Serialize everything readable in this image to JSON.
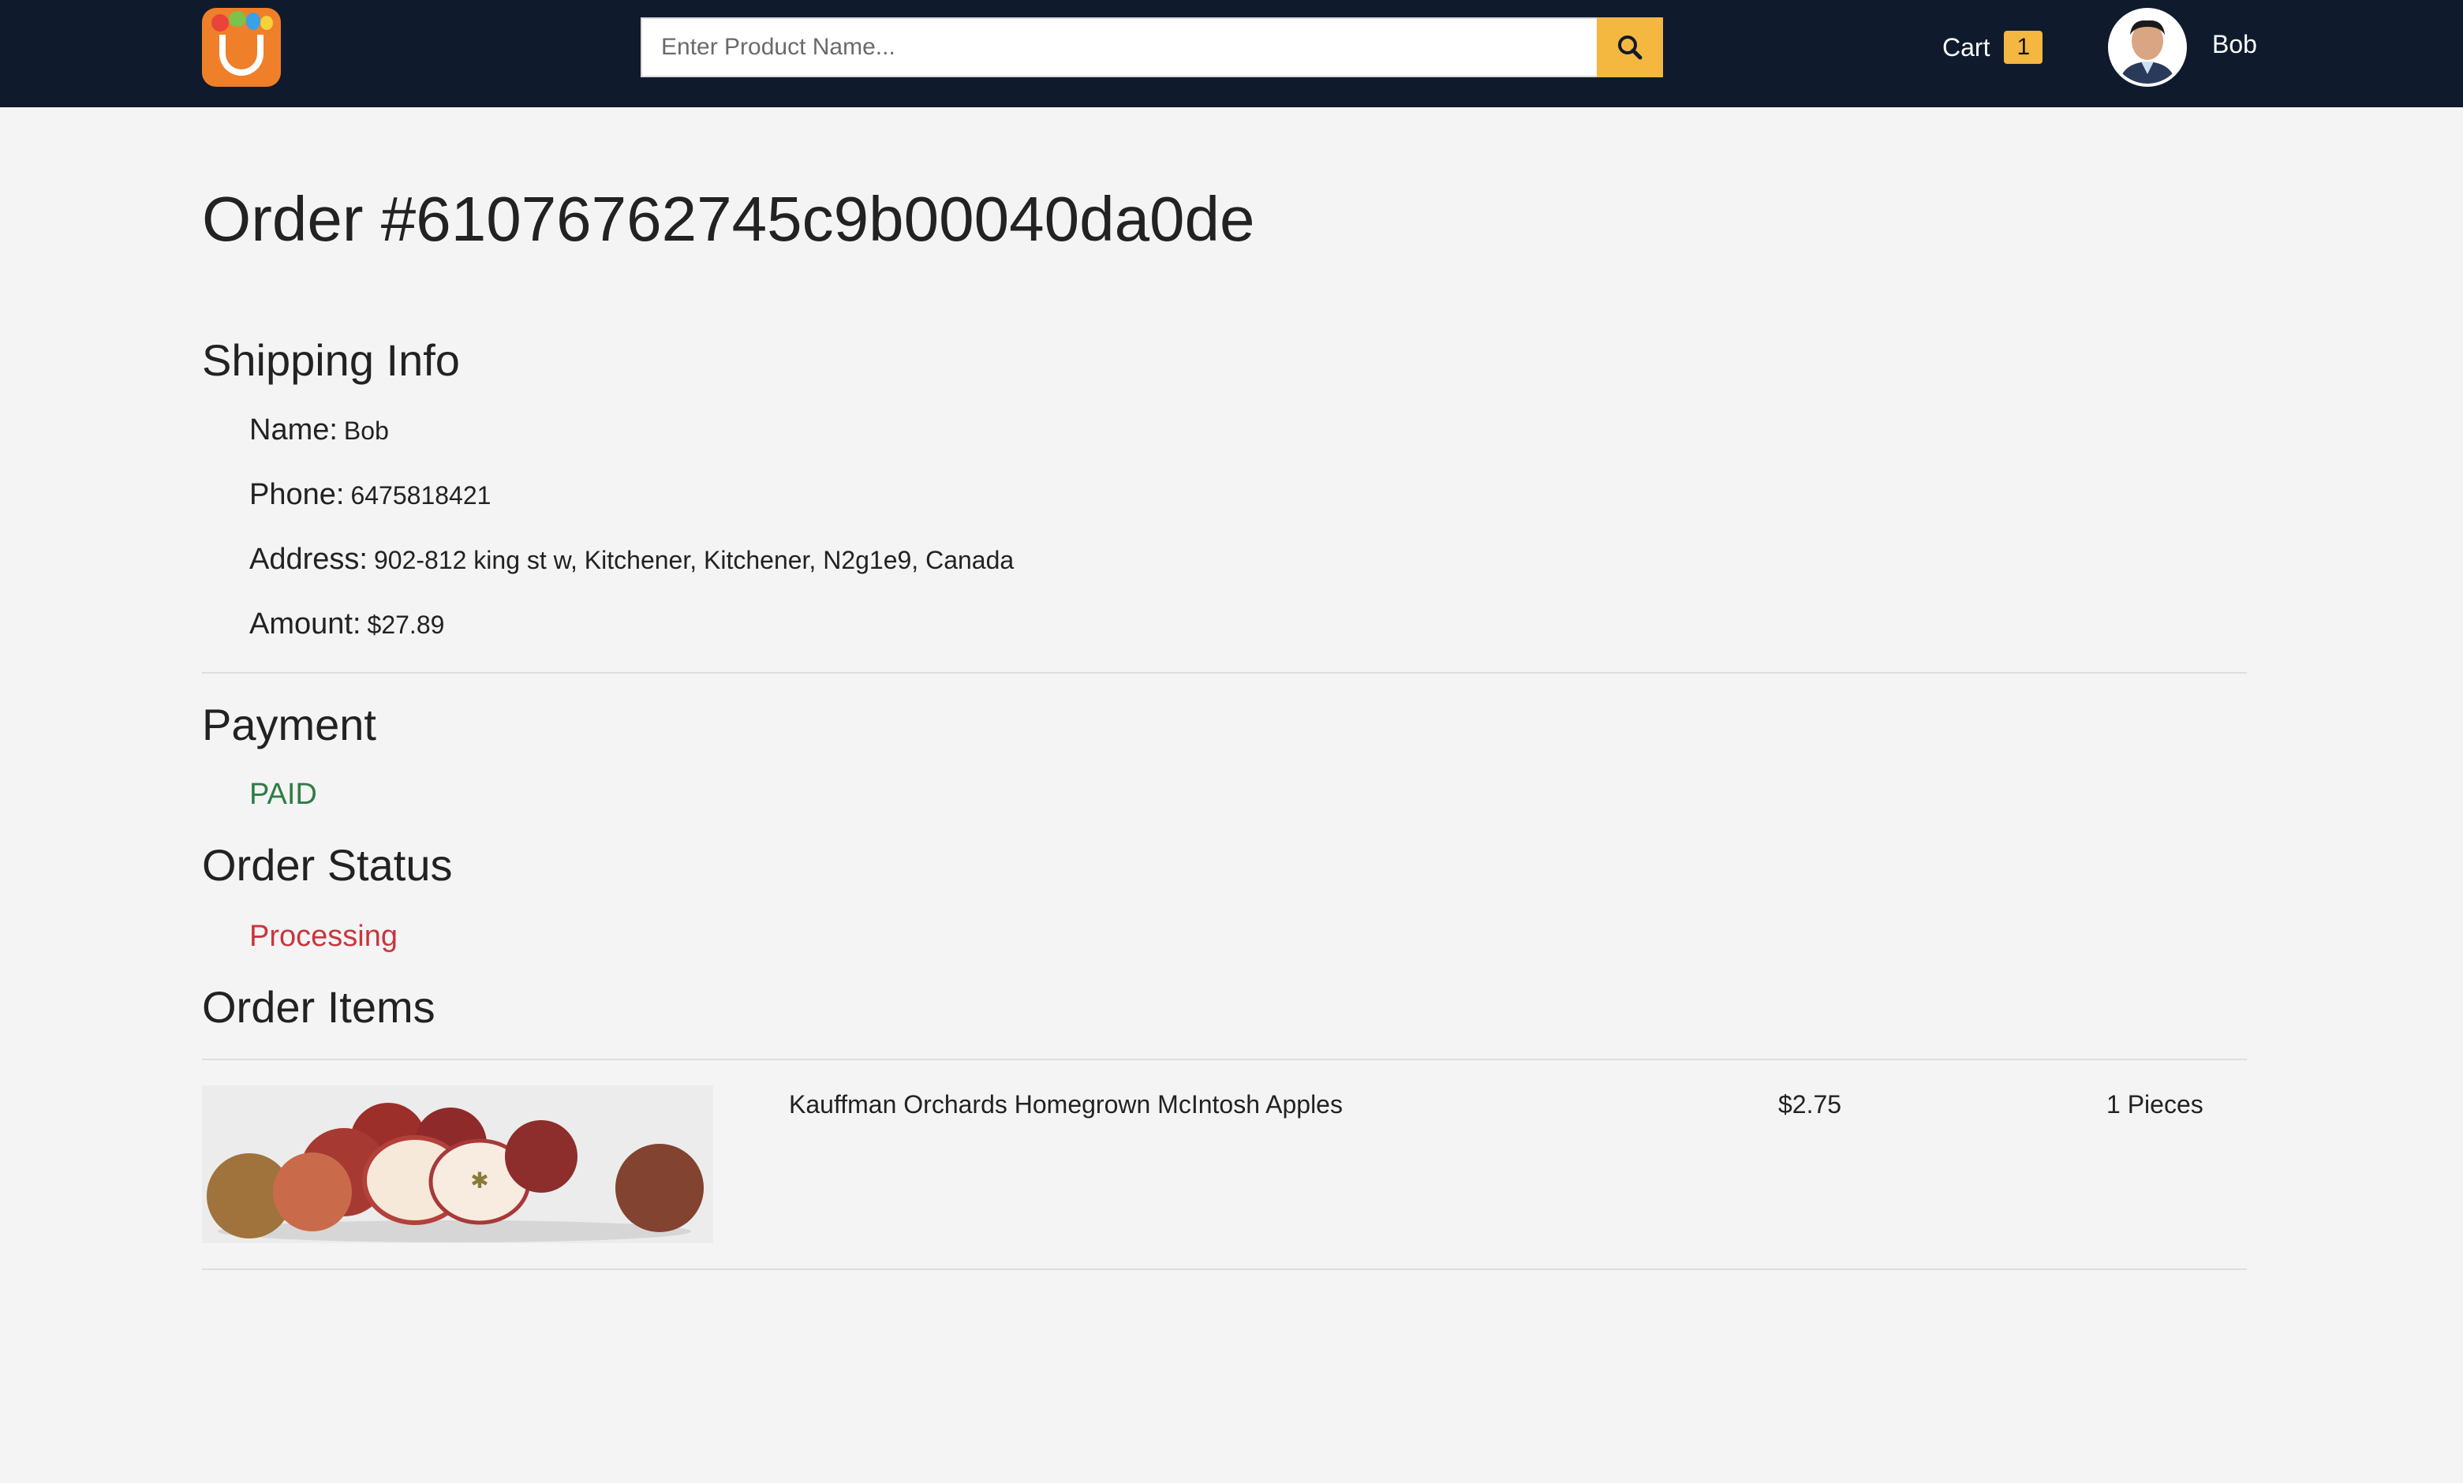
{
  "header": {
    "search_placeholder": "Enter Product Name...",
    "cart_label": "Cart",
    "cart_count": "1",
    "user_name": "Bob"
  },
  "order": {
    "title": "Order #61076762745c9b00040da0de"
  },
  "shipping": {
    "heading": "Shipping Info",
    "name_label": "Name:",
    "name_value": "Bob",
    "phone_label": "Phone:",
    "phone_value": "6475818421",
    "address_label": "Address:",
    "address_value": "902-812 king st w, Kitchener, Kitchener, N2g1e9, Canada",
    "amount_label": "Amount:",
    "amount_value": "$27.89"
  },
  "payment": {
    "heading": "Payment",
    "status": "PAID"
  },
  "order_status": {
    "heading": "Order Status",
    "status": "Processing"
  },
  "order_items": {
    "heading": "Order Items",
    "items": [
      {
        "name": "Kauffman Orchards Homegrown McIntosh Apples",
        "price": "$2.75",
        "quantity": "1 Pieces"
      }
    ]
  },
  "colors": {
    "navbar": "#0f1b2d",
    "accent": "#f4b740",
    "paid": "#2f7d46",
    "processing": "#c9363e"
  }
}
